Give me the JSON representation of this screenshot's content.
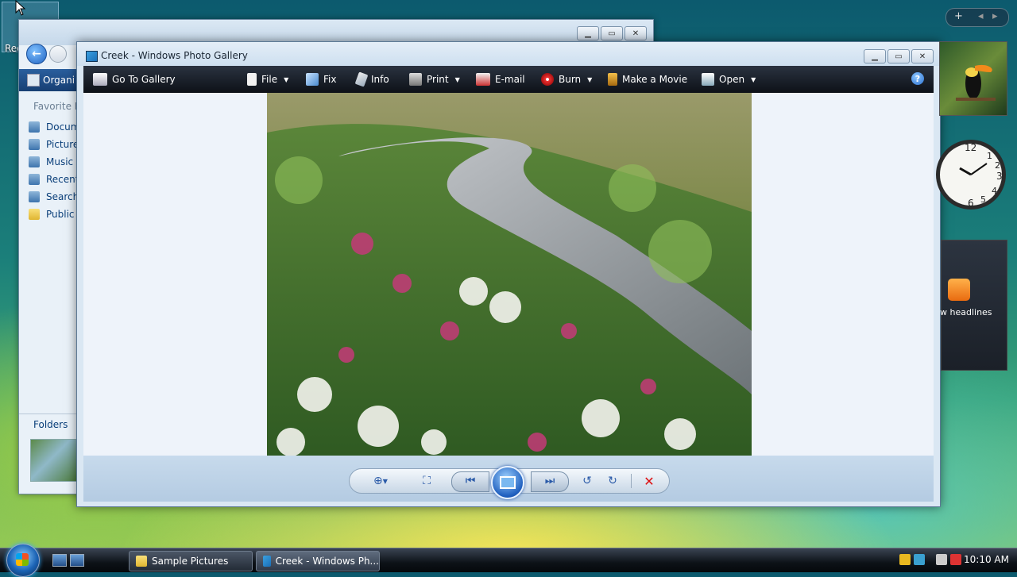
{
  "desktop": {
    "icon_label": "Rec"
  },
  "explorer": {
    "organize_label": "Organi",
    "favorite_links_header": "Favorite Li",
    "favorite_links": [
      "Docum",
      "Picture",
      "Music",
      "Recent",
      "Search",
      "Public"
    ],
    "folders_label": "Folders"
  },
  "gallery": {
    "title": "Creek - Windows Photo Gallery",
    "toolbar": {
      "go_to_gallery": "Go To Gallery",
      "file": "File",
      "fix": "Fix",
      "info": "Info",
      "print": "Print",
      "email": "E-mail",
      "burn": "Burn",
      "make_movie": "Make a Movie",
      "open": "Open",
      "help": "?"
    }
  },
  "sidebar": {
    "news_label": "w headlines"
  },
  "taskbar": {
    "buttons": [
      "Sample Pictures",
      "Creek - Windows Ph..."
    ],
    "clock": "10:10 AM"
  },
  "colors": {
    "toolbar_bg": "#0d1117",
    "accent": "#1f63c2"
  }
}
